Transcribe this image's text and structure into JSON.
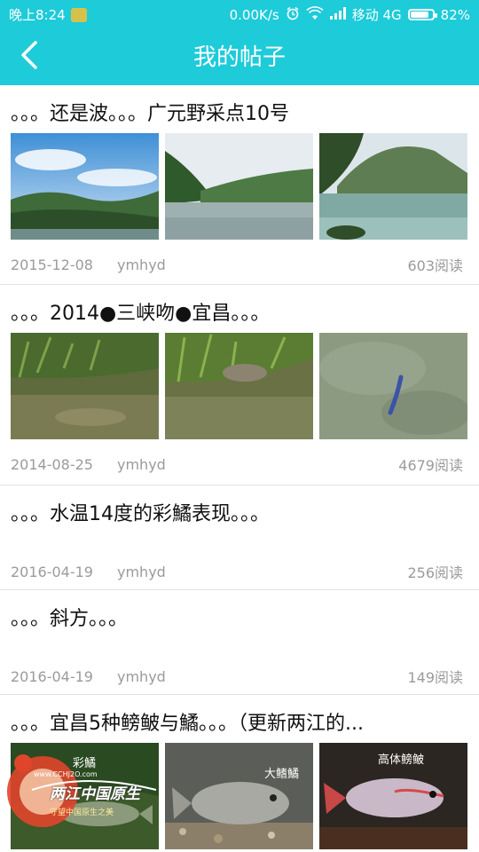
{
  "status": {
    "time": "晚上8:24",
    "speed": "0.00K/s",
    "carrier": "移动 4G",
    "battery": "82%",
    "battery_level": 0.82
  },
  "header": {
    "title": "我的帖子"
  },
  "posts": [
    {
      "title": "。。。还是波。。。广元野采点10号",
      "date": "2015-12-08",
      "author": "ymhyd",
      "reads": "603阅读"
    },
    {
      "title": "。。。2014●三峡吻●宜昌。。。",
      "date": "2014-08-25",
      "author": "ymhyd",
      "reads": "4679阅读"
    },
    {
      "title": "。。。水温14度的彩鱊表现。。。",
      "date": "2016-04-19",
      "author": "ymhyd",
      "reads": "256阅读"
    },
    {
      "title": "。。。斜方。。。",
      "date": "2016-04-19",
      "author": "ymhyd",
      "reads": "149阅读"
    },
    {
      "title": "。。。宜昌5种鳑鲏与鱊。。。（更新两江的...",
      "captions": [
        "彩鱊",
        "大鳍鱊",
        "高体鳑鲏"
      ]
    }
  ],
  "watermark": {
    "text": "两江中国原生",
    "url": "www.CCHJ2O.com",
    "slogan": "守望中国原生之美"
  },
  "colors": {
    "accent": "#1ecbd9"
  }
}
